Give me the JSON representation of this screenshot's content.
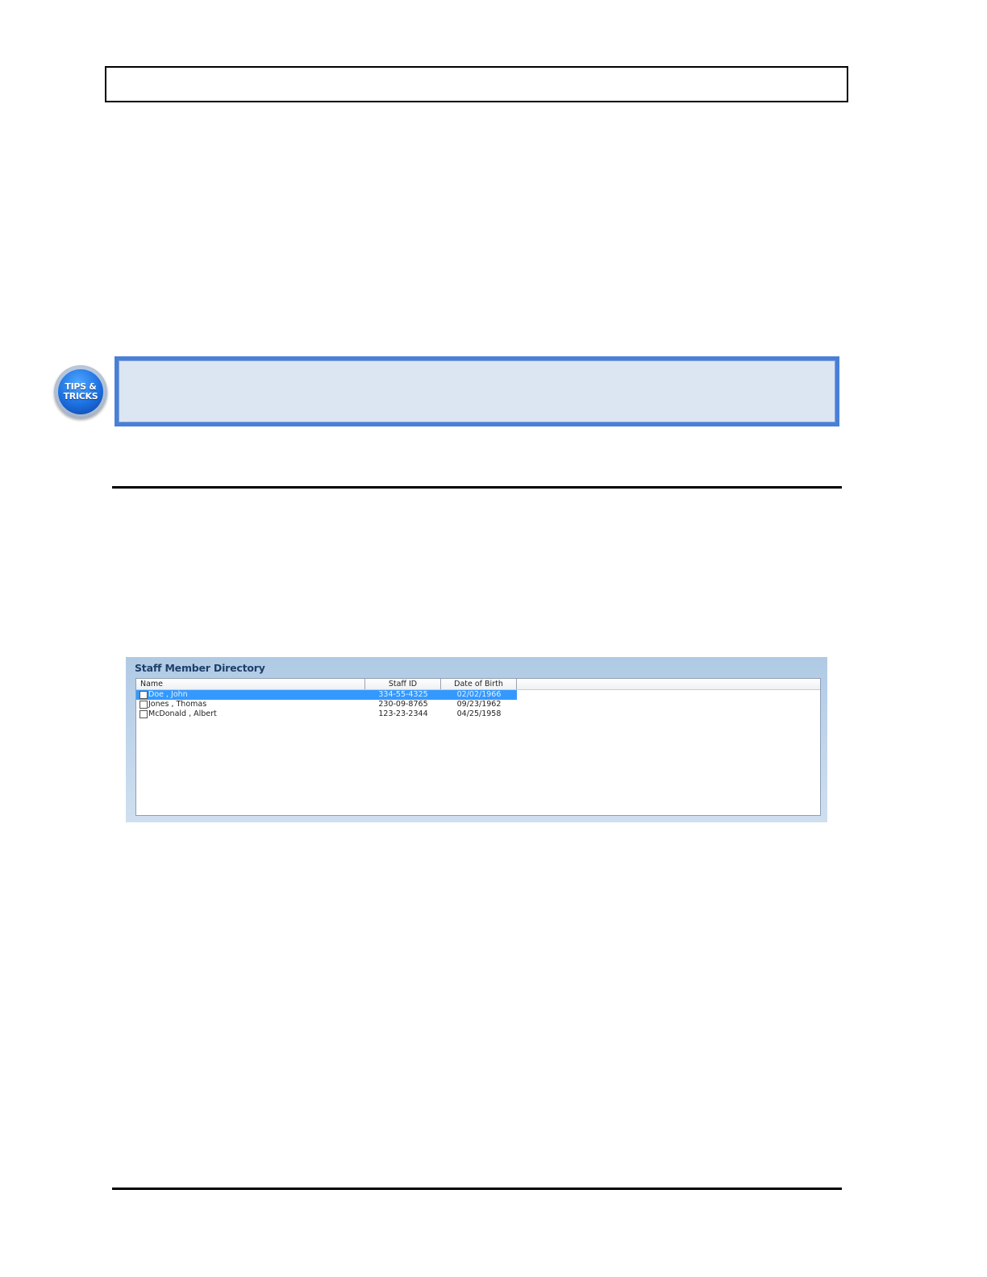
{
  "tips_badge": {
    "line1": "TIPS &",
    "line2": "TRICKS"
  },
  "directory": {
    "title": "Staff Member Directory",
    "columns": [
      "Name",
      "Staff ID",
      "Date of Birth"
    ],
    "rows": [
      {
        "name": "Doe , John",
        "staff_id": "334-55-4325",
        "dob": "02/02/1966",
        "selected": true
      },
      {
        "name": "Jones , Thomas",
        "staff_id": "230-09-8765",
        "dob": "09/23/1962",
        "selected": false
      },
      {
        "name": "McDonald , Albert",
        "staff_id": "123-23-2344",
        "dob": "04/25/1958",
        "selected": false
      }
    ],
    "selection_color": "#3399ff"
  },
  "colors": {
    "tip_border": "#4a7fd6",
    "tip_fill": "#dce6f2",
    "panel_bg": "#b0cae4"
  }
}
